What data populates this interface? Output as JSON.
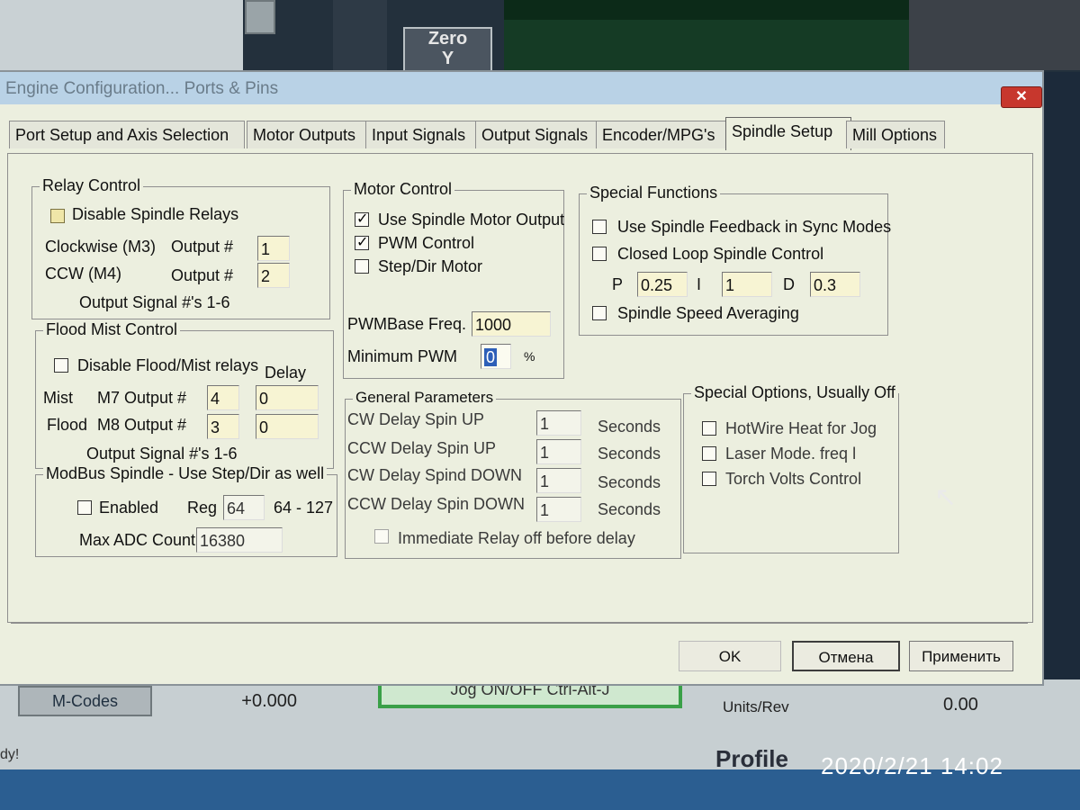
{
  "background": {
    "zero_label": "Zero\nY",
    "mcodes_button": "M-Codes",
    "feed_value": "+0.000",
    "jog_button": "Jog ON/OFF Ctrl-Alt-J",
    "units_rev_label": "Units/Rev",
    "units_rev_value": "0.00",
    "status_text": "dy!",
    "profile_label": "Profile",
    "timestamp": "2020/2/21  14:02"
  },
  "dialog": {
    "title": "Engine Configuration... Ports & Pins",
    "close_label": "✕",
    "tabs": [
      {
        "label": "Port Setup and Axis Selection"
      },
      {
        "label": "Motor Outputs"
      },
      {
        "label": "Input Signals"
      },
      {
        "label": "Output Signals"
      },
      {
        "label": "Encoder/MPG's"
      },
      {
        "label": "Spindle Setup"
      },
      {
        "label": "Mill Options"
      }
    ],
    "active_tab": "Spindle Setup"
  },
  "relay_control": {
    "title": "Relay Control",
    "disable_label": "Disable Spindle Relays",
    "disable_checked": false,
    "cw_label": "Clockwise (M3)",
    "cw_output_label": "Output #",
    "cw_output_value": "1",
    "ccw_label": "CCW (M4)",
    "ccw_output_label": "Output #",
    "ccw_output_value": "2",
    "note": "Output Signal #'s 1-6"
  },
  "flood_mist": {
    "title": "Flood Mist Control",
    "disable_label": "Disable Flood/Mist relays",
    "disable_checked": false,
    "delay_label": "Delay",
    "mist_label": "Mist",
    "mist_output_label": "M7 Output #",
    "mist_output_value": "4",
    "mist_delay_value": "0",
    "flood_label": "Flood",
    "flood_output_label": "M8 Output #",
    "flood_output_value": "3",
    "flood_delay_value": "0",
    "note": "Output Signal #'s 1-6"
  },
  "modbus": {
    "title": "ModBus Spindle - Use Step/Dir as well",
    "enabled_label": "Enabled",
    "enabled_checked": false,
    "reg_label": "Reg",
    "reg_value": "64",
    "reg_range": "64 - 127",
    "adc_label": "Max ADC Count",
    "adc_value": "16380"
  },
  "motor_control": {
    "title": "Motor Control",
    "use_spindle_label": "Use Spindle Motor Output",
    "use_spindle_checked": true,
    "pwm_label": "PWM Control",
    "pwm_checked": true,
    "stepdir_label": "Step/Dir Motor",
    "stepdir_checked": false,
    "pwm_base_label": "PWMBase Freq.",
    "pwm_base_value": "1000",
    "min_pwm_label": "Minimum PWM",
    "min_pwm_value": "0",
    "min_pwm_unit": "%"
  },
  "special_functions": {
    "title": "Special Functions",
    "feedback_label": "Use Spindle Feedback in Sync Modes",
    "feedback_checked": false,
    "closed_loop_label": "Closed Loop Spindle Control",
    "closed_loop_checked": false,
    "p_label": "P",
    "p_value": "0.25",
    "i_label": "I",
    "i_value": "1",
    "d_label": "D",
    "d_value": "0.3",
    "averaging_label": "Spindle Speed Averaging",
    "averaging_checked": false
  },
  "general_parameters": {
    "title": "General Parameters",
    "rows": [
      {
        "label": "CW Delay Spin UP",
        "value": "1",
        "unit": "Seconds"
      },
      {
        "label": "CCW Delay Spin UP",
        "value": "1",
        "unit": "Seconds"
      },
      {
        "label": "CW Delay Spind DOWN",
        "value": "1",
        "unit": "Seconds"
      },
      {
        "label": "CCW Delay Spin DOWN",
        "value": "1",
        "unit": "Seconds"
      }
    ],
    "immediate_label": "Immediate Relay off before delay",
    "immediate_checked": false
  },
  "special_options": {
    "title": "Special Options, Usually Off",
    "hotwire_label": "HotWire Heat for Jog",
    "laser_label": "Laser Mode. freq l",
    "torch_label": "Torch Volts Control"
  },
  "buttons": {
    "ok": "OK",
    "cancel": "Отмена",
    "apply": "Применить"
  },
  "colors": {
    "dialog_bg": "#ecefdf",
    "titlebar": "#b9d2e6",
    "close": "#c7372d"
  }
}
